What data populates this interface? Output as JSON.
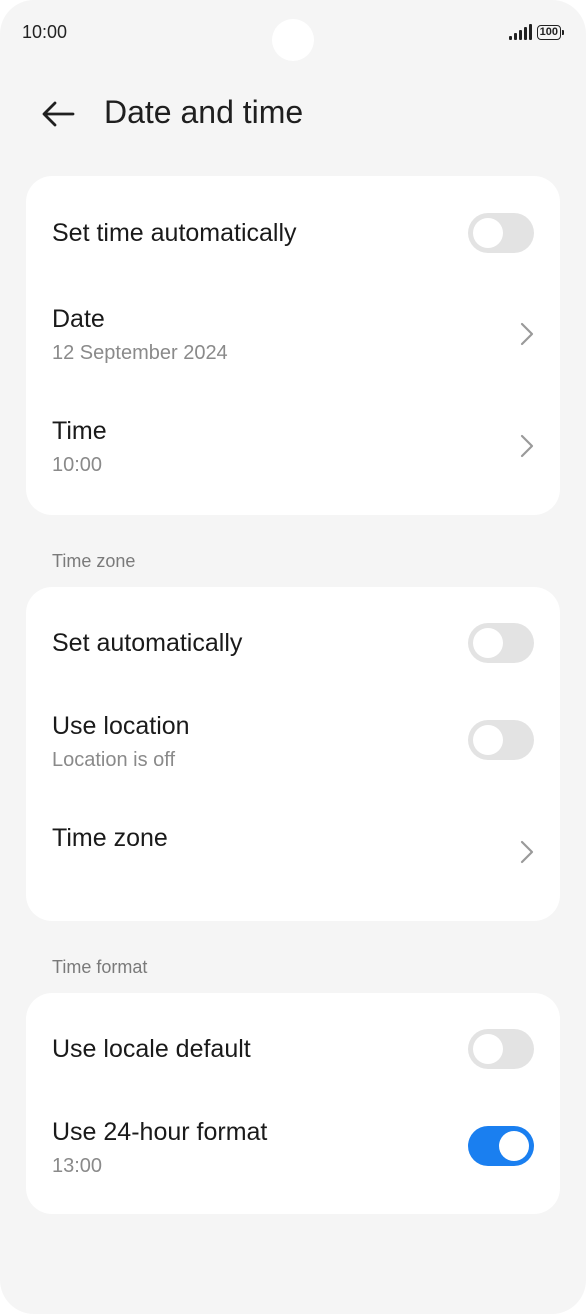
{
  "status_bar": {
    "time": "10:00",
    "battery": "100",
    "icons": [
      "signal-icon",
      "battery-icon"
    ]
  },
  "header": {
    "title": "Date and time",
    "back_icon": "arrow-left-icon"
  },
  "card_datetime": {
    "set_time_auto": {
      "label": "Set time automatically",
      "on": false
    },
    "date": {
      "label": "Date",
      "value": "12 September 2024"
    },
    "time": {
      "label": "Time",
      "value": "10:00"
    }
  },
  "section_timezone": {
    "label": "Time zone",
    "set_auto": {
      "label": "Set automatically",
      "on": false
    },
    "use_location": {
      "label": "Use location",
      "sub": "Location is off",
      "on": false
    },
    "time_zone": {
      "label": "Time zone"
    }
  },
  "section_timeformat": {
    "label": "Time format",
    "locale_default": {
      "label": "Use locale default",
      "on": false
    },
    "use_24h": {
      "label": "Use 24-hour format",
      "sub": "13:00",
      "on": true
    }
  },
  "colors": {
    "toggle_on": "#1a7ff0",
    "toggle_off": "#e3e3e3",
    "background": "#f5f5f5",
    "card": "#ffffff"
  }
}
